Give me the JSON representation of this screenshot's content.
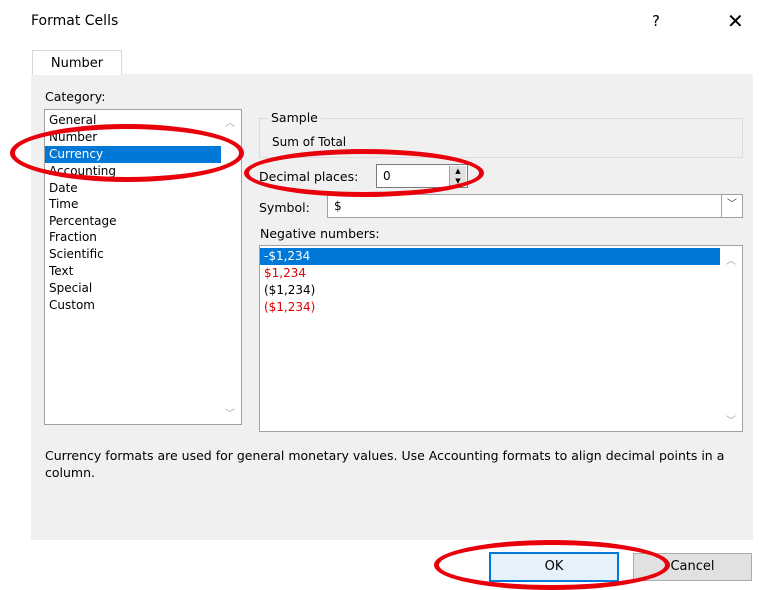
{
  "window": {
    "title": "Format Cells",
    "help_glyph": "?",
    "close_glyph": "✕"
  },
  "tabs": [
    {
      "label": "Number"
    }
  ],
  "category": {
    "label": "Category:",
    "items": [
      "General",
      "Number",
      "Currency",
      "Accounting",
      "Date",
      "Time",
      "Percentage",
      "Fraction",
      "Scientific",
      "Text",
      "Special",
      "Custom"
    ],
    "selected": "Currency"
  },
  "sample": {
    "caption": "Sample",
    "value": "Sum of Total"
  },
  "decimal_places": {
    "label": "Decimal places:",
    "value": "0"
  },
  "symbol": {
    "label": "Symbol:",
    "value": "$"
  },
  "negative_numbers": {
    "label": "Negative numbers:",
    "items": [
      {
        "text": "-$1,234",
        "color": "#000000",
        "selected": true
      },
      {
        "text": "$1,234",
        "color": "#e00000",
        "selected": false
      },
      {
        "text": "($1,234)",
        "color": "#000000",
        "selected": false
      },
      {
        "text": "($1,234)",
        "color": "#e00000",
        "selected": false
      }
    ]
  },
  "description": "Currency formats are used for general monetary values.  Use Accounting formats to align decimal points in a column.",
  "buttons": {
    "ok": "OK",
    "cancel": "Cancel"
  },
  "colors": {
    "selection": "#0078d7",
    "annotation_oval": "#e8000b",
    "negative_red": "#e00000"
  },
  "icons": {
    "close": "close-icon",
    "help": "help-icon",
    "spin_up": "chevron-up-icon",
    "spin_down": "chevron-down-icon",
    "dropdown": "chevron-down-icon"
  }
}
